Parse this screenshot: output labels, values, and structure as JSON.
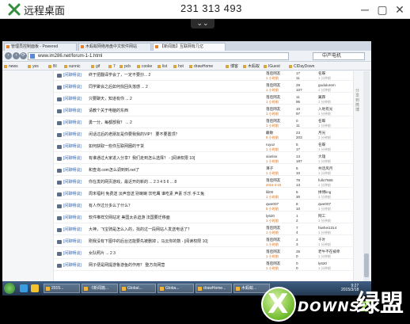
{
  "remote": {
    "title": "远程桌面",
    "id": "231 313 493",
    "min_glyph": "─",
    "max_glyph": "▢",
    "close_glyph": "✕",
    "grip_glyph": "⌄⌄"
  },
  "browser": {
    "tabs": [
      {
        "label": "管理员控制面板 - Powered"
      },
      {
        "label": "木蚂蚁网络用盘中文软件网站"
      },
      {
        "label": "【新闻篇】互联网有几亿"
      }
    ],
    "url": "www.im286.net/forum-1-1.html",
    "search": "中产电机",
    "back_glyph": "‹",
    "fwd_glyph": "›",
    "reload_glyph": "⟳",
    "bookmarks": [
      "news",
      "yes",
      "BI",
      "sunnic",
      "gif",
      "7",
      "pcb",
      "cooke",
      "list",
      "hot",
      "drawHome",
      "博客",
      "木蚂蚁",
      "IGuest",
      "ClDayDown"
    ],
    "status": ""
  },
  "threads": [
    {
      "tag": "[闲聊畅谈]",
      "title": "终于把翻译学会了，一定不要抄... 2",
      "author": "落后网友",
      "date": "1 小时前",
      "count": "17",
      "views": "11",
      "last": "名蝶",
      "last_date": "1 分钟前"
    },
    {
      "tag": "[闲聊畅谈]",
      "title": "同学聚会之后如何找回失落感 ... 2",
      "author": "落后网友",
      "date": "1 小时前",
      "count": "29",
      "views": "107",
      "last": "gudulurem",
      "last_date": "1 分钟前"
    },
    {
      "tag": "[闲聊畅谈]",
      "title": "只要聊天，知道有你 ... 2",
      "author": "落后网友",
      "date": "1 小时前",
      "count": "11",
      "views": "95",
      "last": "翼霖",
      "last_date": "1 分钟前"
    },
    {
      "tag": "[闲聊畅谈]",
      "title": "请教个关于电脑的东西",
      "author": "落后网友",
      "date": "1 小时前",
      "count": "10",
      "views": "97",
      "last": "入地有光",
      "last_date": "1 分钟前"
    },
    {
      "tag": "[闲聊畅谈]",
      "title": "勇一分，每都部我？ ... 2",
      "author": "落后网友",
      "date": "1 小时前",
      "count": "0",
      "views": "11",
      "last": "名蝶",
      "last_date": "1 分钟前"
    },
    {
      "tag": "[闲聊畅谈]",
      "title": "闲话过后的老朋友是你要我我的VIP！ 要不要置顶？",
      "author": "戴敏",
      "date": "5 小时前",
      "count": "23",
      "views": "203",
      "last": "月光",
      "last_date": "1 分钟前"
    },
    {
      "tag": "[闲聊畅谈]",
      "title": "如何获取一些你互联网圈的干货",
      "author": "ruyuz",
      "date": "1 小时前",
      "count": "5",
      "views": "17",
      "last": "名蝶",
      "last_date": "1 分钟前"
    },
    {
      "tag": "[闲聊畅谈]",
      "title": "有谁通过大家进入分享？我们走到怎么选择？ - [阅读权限 10]",
      "author": "xianlox",
      "date": "1 小时前",
      "count": "13",
      "views": "187",
      "last": "大雄",
      "last_date": "1 分钟前"
    },
    {
      "tag": "[闲聊畅谈]",
      "title": "和查询.com怎么调到到.net了",
      "author": "薄子",
      "date": "1 小时前",
      "count": "6",
      "views": "10",
      "last": "共话风月",
      "last_date": "1 分钟前"
    },
    {
      "tag": "[闲聊畅谈]",
      "title": "你在发的网页游戏，最近开的新的 ... 2 3 4 5 6 ... 8",
      "author": "落后网友",
      "date": "2015-3-16",
      "count": "78",
      "views": "13",
      "last": "fullo7555",
      "last_date": "1 分钟前"
    },
    {
      "tag": "[闲聊畅谈]",
      "title": "周末福利 免费送 淡声音送 别喇喇 饮吃鹰 谁吃素 声素 乐乐 手工兔",
      "author": "lili00",
      "date": "1 小时前",
      "count": "5",
      "views": "30",
      "last": "拼博ling",
      "last_date": "1 分钟前"
    },
    {
      "tag": "[闲聊畅谈]",
      "title": "有人作过分多么了什么？",
      "author": "qwe007",
      "date": "5 小时前",
      "count": "8",
      "views": "10",
      "last": "qwe007",
      "last_date": "1 分钟前"
    },
    {
      "tag": "[闲聊畅谈]",
      "title": "软件推样交网站定 美国太杀迫游 法国要迁移面",
      "author": "ly620",
      "date": "1 小时前",
      "count": "1",
      "views": "2",
      "last": "网工",
      "last_date": "1 分钟前"
    },
    {
      "tag": "[闲聊畅谈]",
      "title": "大神，飞宝骑是怎么入的，找的过一段网站人发送电话了？",
      "author": "落后网友",
      "date": "1 小时前",
      "count": "7",
      "views": "4",
      "last": "hiwhei1314",
      "last_date": "1 分钟前"
    },
    {
      "tag": "[闲聊畅谈]",
      "title": "刚我没有下图中的后台还能要先被删掉 ，马云你的数 - [阅读权限 10]",
      "author": "落后网友",
      "date": "1 小时前",
      "count": "2",
      "views": "3",
      "last": "千叶",
      "last_date": "1 分钟前"
    },
    {
      "tag": "[闲聊畅谈]",
      "title": "女队照片 ... 2 3",
      "author": "落后网友",
      "date": "1 小时前",
      "count": "25",
      "views": "0",
      "last": "老牛不在被牵",
      "last_date": "1 分钟前"
    },
    {
      "tag": "[闲聊畅谈]",
      "title": "网子便是网提游鲁游鱼的作用？ 整方向网营",
      "author": "落后网友",
      "date": "1 小时前",
      "count": "0",
      "views": "0",
      "last": "ly620",
      "last_date": "1 分钟前"
    }
  ],
  "side_text": "分享到微博",
  "taskbar": {
    "items": [
      "2015...",
      "《新闻篇...",
      "Global...",
      "Globa...",
      "drawHome...",
      "木蚂蚁..."
    ],
    "clock_time": "9:27",
    "clock_date": "2015/3/18"
  },
  "watermark": {
    "x": "X",
    "text_a": "DOWNS",
    "dot": "Z",
    "text_b": "下载",
    "cn": "绿盟"
  }
}
